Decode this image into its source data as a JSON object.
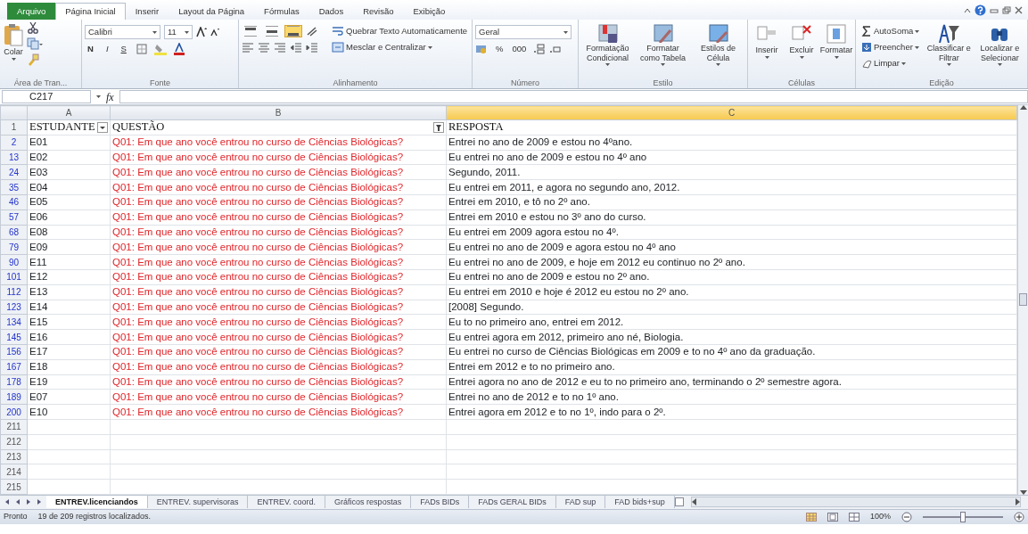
{
  "ribbon_tabs": [
    {
      "label": "Arquivo",
      "kind": "file",
      "selected": false
    },
    {
      "label": "Página Inicial",
      "kind": "tab",
      "selected": true
    },
    {
      "label": "Inserir",
      "kind": "tab",
      "selected": false
    },
    {
      "label": "Layout da Página",
      "kind": "tab",
      "selected": false
    },
    {
      "label": "Fórmulas",
      "kind": "tab",
      "selected": false
    },
    {
      "label": "Dados",
      "kind": "tab",
      "selected": false
    },
    {
      "label": "Revisão",
      "kind": "tab",
      "selected": false
    },
    {
      "label": "Exibição",
      "kind": "tab",
      "selected": false
    }
  ],
  "clipboard": {
    "paste": "Colar",
    "label": "Área de Tran..."
  },
  "font": {
    "name": "Calibri",
    "size": "11",
    "bold": "N",
    "italic": "I",
    "underline": "S",
    "label": "Fonte"
  },
  "alignment": {
    "vertical_align": [
      {
        "selected": false
      },
      {
        "selected": false
      },
      {
        "selected": true
      }
    ],
    "wrap": "Quebrar Texto Automaticamente",
    "merge": "Mesclar e Centralizar",
    "label": "Alinhamento"
  },
  "number": {
    "format": "Geral",
    "percent": "%",
    "thousands": "000",
    "label": "Número"
  },
  "styles": {
    "buttons": [
      "Formatação Condicional",
      "Formatar como Tabela",
      "Estilos de Célula"
    ],
    "label": "Estilo"
  },
  "cells": {
    "buttons": [
      "Inserir",
      "Excluir",
      "Formatar"
    ],
    "label": "Células"
  },
  "editing": {
    "small": [
      "AutoSoma",
      "Preencher",
      "Limpar"
    ],
    "big": [
      "Classificar e Filtrar",
      "Localizar e Selecionar"
    ],
    "label": "Edição"
  },
  "formula_bar": {
    "name_box": "C217",
    "fx": "fx"
  },
  "columns": [
    {
      "label": "A",
      "selected": false
    },
    {
      "label": "B",
      "selected": false
    },
    {
      "label": "C",
      "selected": true
    }
  ],
  "header_row": {
    "number": "1",
    "cells": [
      {
        "text": "ESTUDANTE",
        "kind": "dropdown"
      },
      {
        "text": "QUESTÃO",
        "kind": "filtered"
      },
      {
        "text": "RESPOSTA",
        "kind": "plain"
      }
    ]
  },
  "rows": [
    {
      "number": "2",
      "student": "E01",
      "question": "Q01: Em que ano você entrou no curso de Ciências Biológicas?",
      "answer": "Entrei no ano de 2009 e estou no 4ºano."
    },
    {
      "number": "13",
      "student": "E02",
      "question": "Q01: Em que ano você entrou no curso de Ciências Biológicas?",
      "answer": "Eu entrei no ano de 2009 e estou no 4º ano"
    },
    {
      "number": "24",
      "student": "E03",
      "question": "Q01: Em que ano você entrou no curso de Ciências Biológicas?",
      "answer": "Segundo, 2011."
    },
    {
      "number": "35",
      "student": "E04",
      "question": "Q01: Em que ano você entrou no curso de Ciências Biológicas?",
      "answer": "Eu entrei em 2011, e agora no segundo ano, 2012."
    },
    {
      "number": "46",
      "student": "E05",
      "question": "Q01: Em que ano você entrou no curso de Ciências Biológicas?",
      "answer": "Entrei em 2010, e tô no 2º ano."
    },
    {
      "number": "57",
      "student": "E06",
      "question": "Q01: Em que ano você entrou no curso de Ciências Biológicas?",
      "answer": "Entrei em 2010 e estou no 3º ano do curso."
    },
    {
      "number": "68",
      "student": "E08",
      "question": "Q01: Em que ano você entrou no curso de Ciências Biológicas?",
      "answer": "Eu entrei em 2009 agora estou no 4º."
    },
    {
      "number": "79",
      "student": "E09",
      "question": "Q01: Em que ano você entrou no curso de Ciências Biológicas?",
      "answer": "Eu entrei no ano de 2009 e agora estou no 4º ano"
    },
    {
      "number": "90",
      "student": "E11",
      "question": "Q01: Em que ano você entrou no curso de Ciências Biológicas?",
      "answer": "Eu entrei no ano de 2009, e hoje em 2012 eu continuo no 2º ano."
    },
    {
      "number": "101",
      "student": "E12",
      "question": "Q01: Em que ano você entrou no curso de Ciências Biológicas?",
      "answer": "Eu entrei no ano de 2009 e estou no 2º ano."
    },
    {
      "number": "112",
      "student": "E13",
      "question": "Q01: Em que ano você entrou no curso de Ciências Biológicas?",
      "answer": "Eu entrei em 2010 e hoje é 2012 eu estou no 2º ano."
    },
    {
      "number": "123",
      "student": "E14",
      "question": "Q01: Em que ano você entrou no curso de Ciências Biológicas?",
      "answer": "[2008] Segundo."
    },
    {
      "number": "134",
      "student": "E15",
      "question": "Q01: Em que ano você entrou no curso de Ciências Biológicas?",
      "answer": "Eu to no primeiro ano, entrei em 2012."
    },
    {
      "number": "145",
      "student": "E16",
      "question": "Q01: Em que ano você entrou no curso de Ciências Biológicas?",
      "answer": "Eu entrei agora em 2012, primeiro ano né, Biologia."
    },
    {
      "number": "156",
      "student": "E17",
      "question": "Q01: Em que ano você entrou no curso de Ciências Biológicas?",
      "answer": "Eu entrei no curso de Ciências Biológicas em 2009 e to no 4º ano da graduação."
    },
    {
      "number": "167",
      "student": "E18",
      "question": "Q01: Em que ano você entrou no curso de Ciências Biológicas?",
      "answer": "Entrei em 2012 e to no primeiro ano."
    },
    {
      "number": "178",
      "student": "E19",
      "question": "Q01: Em que ano você entrou no curso de Ciências Biológicas?",
      "answer": "Entrei agora no ano de 2012 e eu to no primeiro ano, terminando o 2º semestre agora."
    },
    {
      "number": "189",
      "student": "E07",
      "question": "Q01: Em que ano você entrou no curso de Ciências Biológicas?",
      "answer": "Entrei no ano de 2012 e to no 1º ano."
    },
    {
      "number": "200",
      "student": "E10",
      "question": "Q01: Em que ano você entrou no curso de Ciências Biológicas?",
      "answer": "Entrei agora em 2012 e to no 1º, indo para o 2º."
    }
  ],
  "empty_rows": [
    "211",
    "212",
    "213",
    "214",
    "215"
  ],
  "sheet_tabs": [
    {
      "label": "ENTREV.licenciandos",
      "selected": true
    },
    {
      "label": "ENTREV. supervisoras",
      "selected": false
    },
    {
      "label": "ENTREV. coord.",
      "selected": false
    },
    {
      "label": "Gráficos respostas",
      "selected": false
    },
    {
      "label": "FADs BIDs",
      "selected": false
    },
    {
      "label": "FADs GERAL BIDs",
      "selected": false
    },
    {
      "label": "FAD sup",
      "selected": false
    },
    {
      "label": "FAD bids+sup",
      "selected": false
    }
  ],
  "status_bar": {
    "mode": "Pronto",
    "message": "19 de 209 registros localizados.",
    "zoom": "100%",
    "zoom_slider": {
      "level": 0.5
    }
  }
}
